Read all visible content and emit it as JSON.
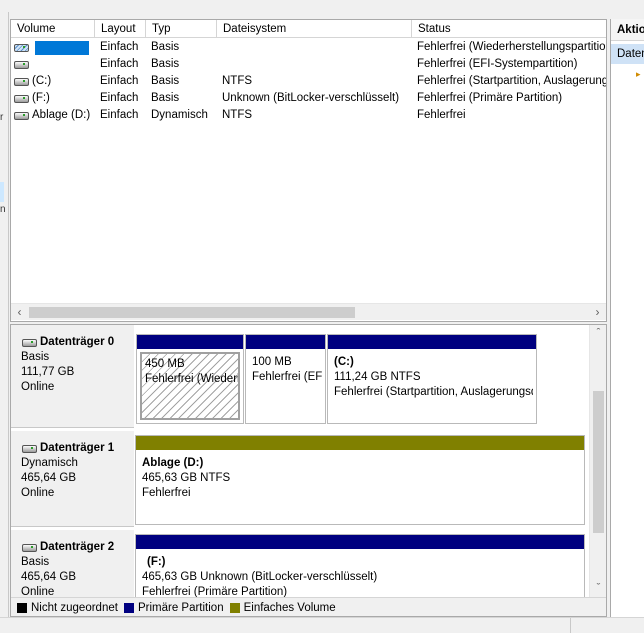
{
  "volume_list": {
    "headers": {
      "volume": "Volume",
      "layout": "Layout",
      "type": "Typ",
      "filesystem": "Dateisystem",
      "status": "Status"
    },
    "rows": [
      {
        "volume": "",
        "layout": "Einfach",
        "type": "Basis",
        "filesystem": "",
        "status": "Fehlerfrei (Wiederherstellungspartition)"
      },
      {
        "volume": "",
        "layout": "Einfach",
        "type": "Basis",
        "filesystem": "",
        "status": "Fehlerfrei (EFI-Systempartition)"
      },
      {
        "volume": "(C:)",
        "layout": "Einfach",
        "type": "Basis",
        "filesystem": "NTFS",
        "status": "Fehlerfrei (Startpartition, Auslagerungsdatei)"
      },
      {
        "volume": "(F:)",
        "layout": "Einfach",
        "type": "Basis",
        "filesystem": "Unknown (BitLocker-verschlüsselt)",
        "status": "Fehlerfrei (Primäre Partition)"
      },
      {
        "volume": "Ablage (D:)",
        "layout": "Einfach",
        "type": "Dynamisch",
        "filesystem": "NTFS",
        "status": "Fehlerfrei"
      }
    ]
  },
  "disks": [
    {
      "name": "Datenträger 0",
      "type": "Basis",
      "size": "111,77 GB",
      "state": "Online",
      "partitions": [
        {
          "title": "",
          "size": "450 MB",
          "status": "Fehlerfrei (Wiederherstellungspartition)"
        },
        {
          "title": "",
          "size": "100 MB",
          "status": "Fehlerfrei (EFI-Systempartition)"
        },
        {
          "title": "(C:)",
          "size": "111,24 GB NTFS",
          "status": "Fehlerfrei (Startpartition, Auslagerungsdatei)"
        }
      ]
    },
    {
      "name": "Datenträger 1",
      "type": "Dynamisch",
      "size": "465,64 GB",
      "state": "Online",
      "partitions": [
        {
          "title": "Ablage  (D:)",
          "size": "465,63 GB NTFS",
          "status": "Fehlerfrei"
        }
      ]
    },
    {
      "name": "Datenträger 2",
      "type": "Basis",
      "size": "465,64 GB",
      "state": "Online",
      "partitions": [
        {
          "title": "(F:)",
          "size": "465,63 GB Unknown (BitLocker-verschlüsselt)",
          "status": "Fehlerfrei (Primäre Partition)"
        }
      ]
    }
  ],
  "legend": [
    {
      "label": "Nicht zugeordnet",
      "color": "#000000"
    },
    {
      "label": "Primäre Partition",
      "color": "#000080"
    },
    {
      "label": "Einfaches Volume",
      "color": "#808000"
    }
  ],
  "actions": {
    "title": "Aktionen",
    "item": "Datenträgerverwaltung"
  },
  "colors": {
    "selection": "#0078d7",
    "primary_bar": "#000080",
    "simple_bar": "#808000"
  }
}
